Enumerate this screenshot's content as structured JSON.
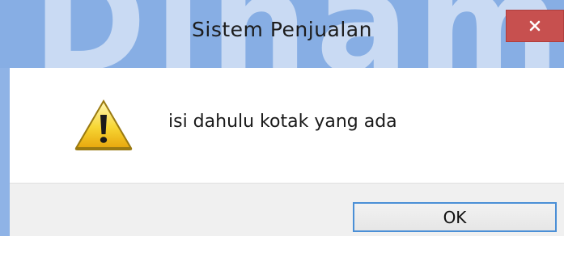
{
  "window": {
    "title": "Sistem Penjualan",
    "close_glyph": "✕"
  },
  "message": {
    "icon": "warning-icon",
    "text": "isi dahulu kotak yang ada"
  },
  "buttons": {
    "ok_label": "OK"
  },
  "colors": {
    "titlebar": "#87aee4",
    "close_button": "#c7504f",
    "ok_border": "#4a8fd6",
    "footer": "#f0f0f0"
  }
}
